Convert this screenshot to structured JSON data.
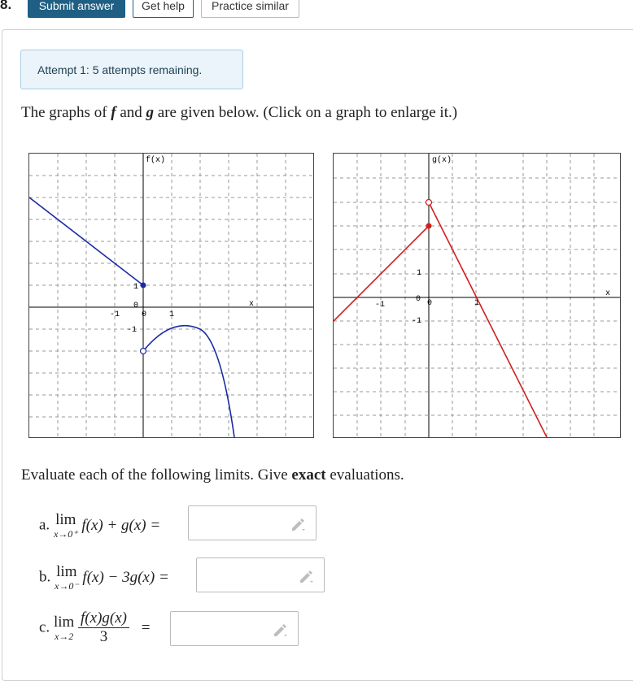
{
  "question_number": "8.",
  "toolbar": {
    "submit_label": "Submit answer",
    "help_label": "Get help",
    "similar_label": "Practice similar"
  },
  "attempt_text": "Attempt 1: 5 attempts remaining.",
  "prompt": {
    "before_f": "The graphs of ",
    "f": "f",
    "and": " and ",
    "g": "g",
    "after_g": " are given below. (Click on a graph to enlarge it.)"
  },
  "graphs": {
    "f": {
      "ylabel": "f(x)",
      "xlabel": "x",
      "tick_neg1_x": "-1",
      "tick_1_x": "1",
      "tick_1_y": "1",
      "tick_neg1_y": "-1",
      "origin_y": "0",
      "origin_x": "0",
      "color": "#1a2aa6"
    },
    "g": {
      "ylabel": "g(x)",
      "xlabel": "x",
      "tick_neg1_x": "-1",
      "tick_1_x": "1",
      "tick_1_y": "1",
      "tick_neg1_y": "-1",
      "origin_y": "0",
      "origin_x": "0",
      "color": "#d21e1e"
    }
  },
  "evaluate": {
    "before": "Evaluate each of the following limits. Give ",
    "bold": "exact",
    "after": " evaluations."
  },
  "parts": [
    {
      "label": "a.",
      "lim": "lim",
      "sub": "x→0⁺",
      "expr": "f(x) + g(x) =",
      "value": ""
    },
    {
      "label": "b.",
      "lim": "lim",
      "sub": "x→0⁻",
      "expr": "f(x) − 3g(x) =",
      "value": ""
    },
    {
      "label": "c.",
      "lim": "lim",
      "sub": "x→2",
      "num": "f(x)g(x)",
      "den": "3",
      "eq": "=",
      "value": ""
    }
  ]
}
